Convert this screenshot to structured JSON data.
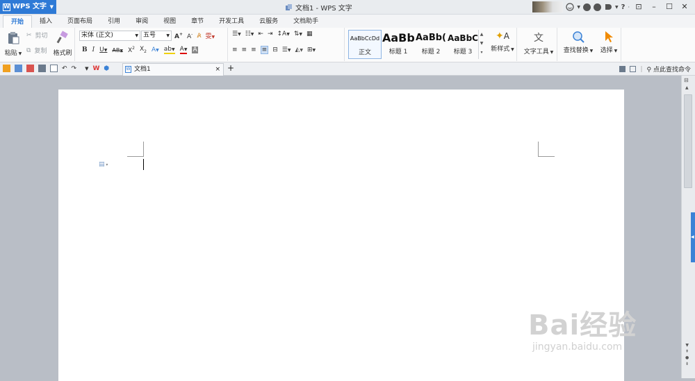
{
  "app": {
    "name": "WPS 文字",
    "window_title": "文档1 - WPS 文字"
  },
  "menu_tabs": [
    "开始",
    "插入",
    "页面布局",
    "引用",
    "审阅",
    "视图",
    "章节",
    "开发工具",
    "云服务",
    "文档助手"
  ],
  "ribbon": {
    "clipboard": {
      "paste": "粘贴",
      "cut": "剪切",
      "copy": "复制",
      "format_painter": "格式刷"
    },
    "font": {
      "name": "宋体 (正文)",
      "size": "五号"
    },
    "styles": [
      {
        "sample": "AaBbCcDd",
        "label": "正文"
      },
      {
        "sample": "AaBb",
        "label": "标题 1"
      },
      {
        "sample": "AaBb(",
        "label": "标题 2"
      },
      {
        "sample": "AaBbC",
        "label": "标题 3"
      }
    ],
    "new_style": "新样式",
    "text_tools": "文字工具",
    "find_replace": "查找替换",
    "select": "选择"
  },
  "doc_tab": {
    "name": "文档1"
  },
  "command_search": "点此查找命令",
  "watermark": {
    "main": "Bai经验",
    "sub": "jingyan.baidu.com"
  },
  "colors": {
    "accent": "#2e7ad6",
    "workspace": "#b9bec6"
  }
}
